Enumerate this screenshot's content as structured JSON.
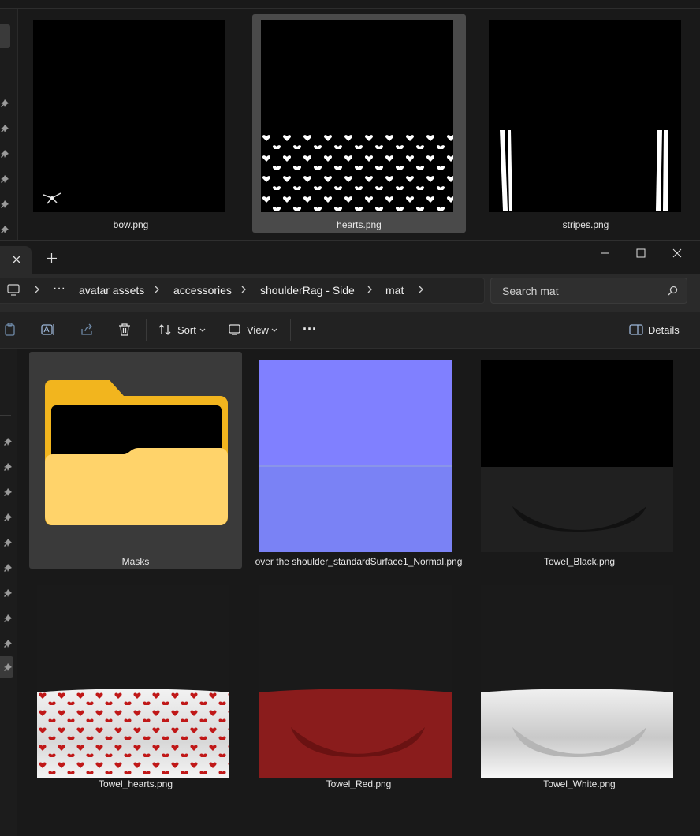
{
  "back_window": {
    "files": [
      {
        "name": "bow.png",
        "selected": false
      },
      {
        "name": "hearts.png",
        "selected": true
      },
      {
        "name": "stripes.png",
        "selected": false
      }
    ]
  },
  "front_window": {
    "tab": {
      "close_icon": "close-icon",
      "new_tab_icon": "plus-icon"
    },
    "window_controls": [
      "minimize-icon",
      "maximize-icon",
      "close-icon"
    ],
    "breadcrumb": [
      "avatar assets",
      "accessories",
      "shoulderRag - Side",
      "mat"
    ],
    "overflow_crumb": "···",
    "search": {
      "placeholder": "Search mat"
    },
    "toolbar": {
      "sort_label": "Sort",
      "view_label": "View",
      "more_label": "···",
      "details_label": "Details"
    },
    "files": [
      {
        "name": "Masks",
        "kind": "folder",
        "selected": true
      },
      {
        "name": "over the shoulder_standardSurface1_Normal.png",
        "kind": "image"
      },
      {
        "name": "Towel_Black.png",
        "kind": "image"
      },
      {
        "name": "Towel_hearts.png",
        "kind": "image"
      },
      {
        "name": "Towel_Red.png",
        "kind": "image"
      },
      {
        "name": "Towel_White.png",
        "kind": "image"
      }
    ],
    "colors": {
      "normal_map": "#8080ff",
      "towel_red": "#8a1c1c",
      "folder_yellow": "#f5c33b"
    }
  }
}
